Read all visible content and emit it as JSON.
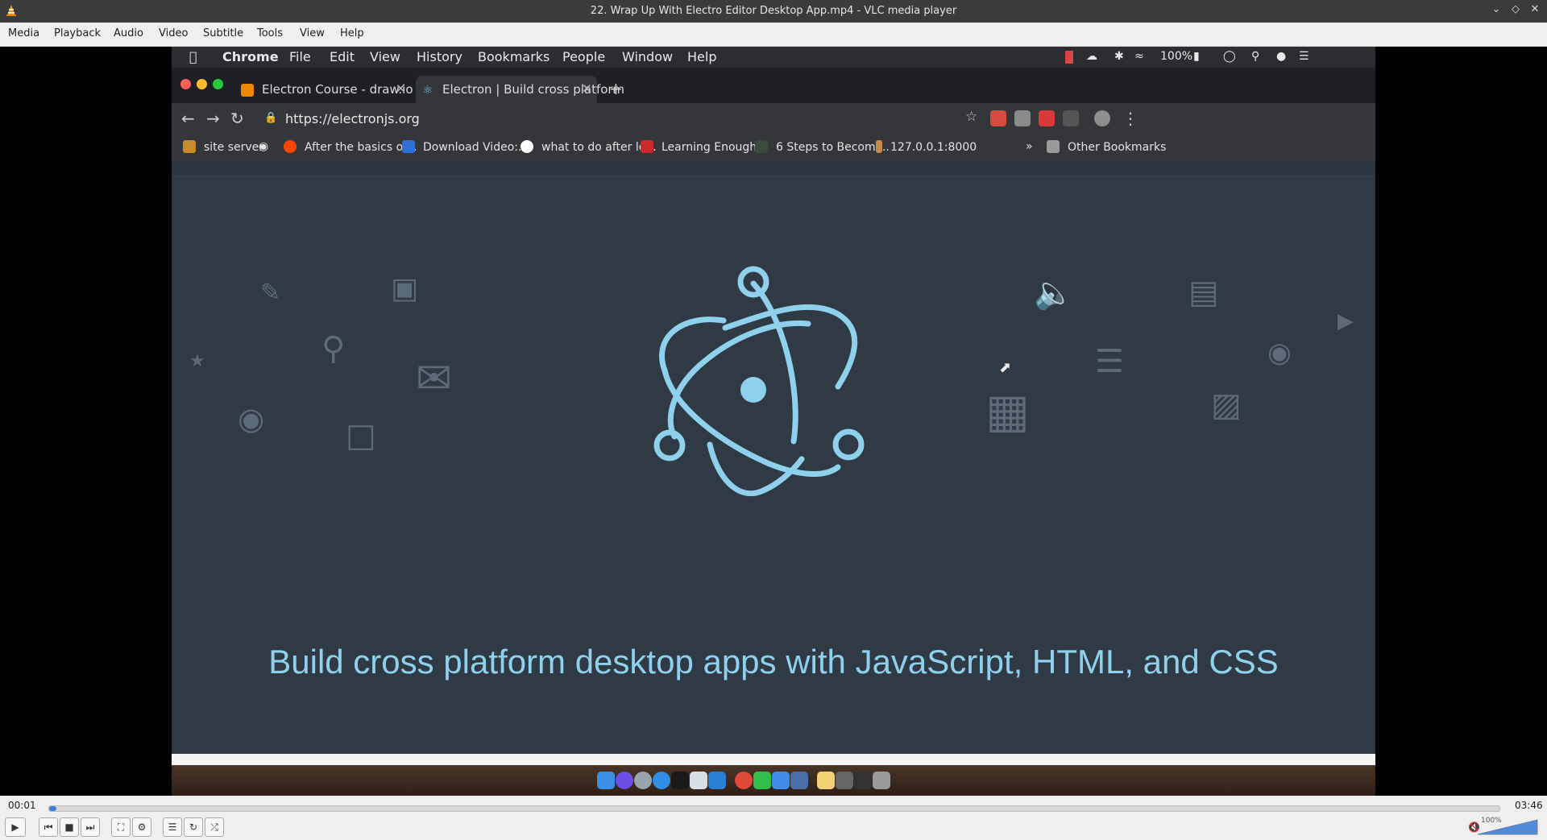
{
  "vlc": {
    "window_title": "22. Wrap Up With Electro Editor Desktop App.mp4 - VLC media player",
    "menu": [
      "Media",
      "Playback",
      "Audio",
      "Video",
      "Subtitle",
      "Tools",
      "View",
      "Help"
    ],
    "time_elapsed": "00:01",
    "time_total": "03:46",
    "progress": 0.005,
    "volume_label": "100%",
    "volume": 1.0
  },
  "mac": {
    "app": "Chrome",
    "menu": [
      "File",
      "Edit",
      "View",
      "History",
      "Bookmarks",
      "People",
      "Window",
      "Help"
    ],
    "battery": "100%"
  },
  "chrome": {
    "tabs": [
      {
        "label": "Electron Course - draw.io"
      },
      {
        "label": "Electron | Build cross platform"
      }
    ],
    "url": "https://electronjs.org",
    "bookmarks": [
      "site server",
      "After the basics of...",
      "Download Video:...",
      "what to do after le...",
      "Learning Enough...",
      "6 Steps to Becomi...",
      "127.0.0.1:8000"
    ],
    "other_bookmarks": "Other Bookmarks"
  },
  "page": {
    "headline": "Build cross platform desktop apps with JavaScript, HTML, and CSS"
  },
  "colors": {
    "electron_blue": "#8fd1ec",
    "page_bg": "#2f3a45",
    "vlc_progress": "#3b7dd8"
  }
}
